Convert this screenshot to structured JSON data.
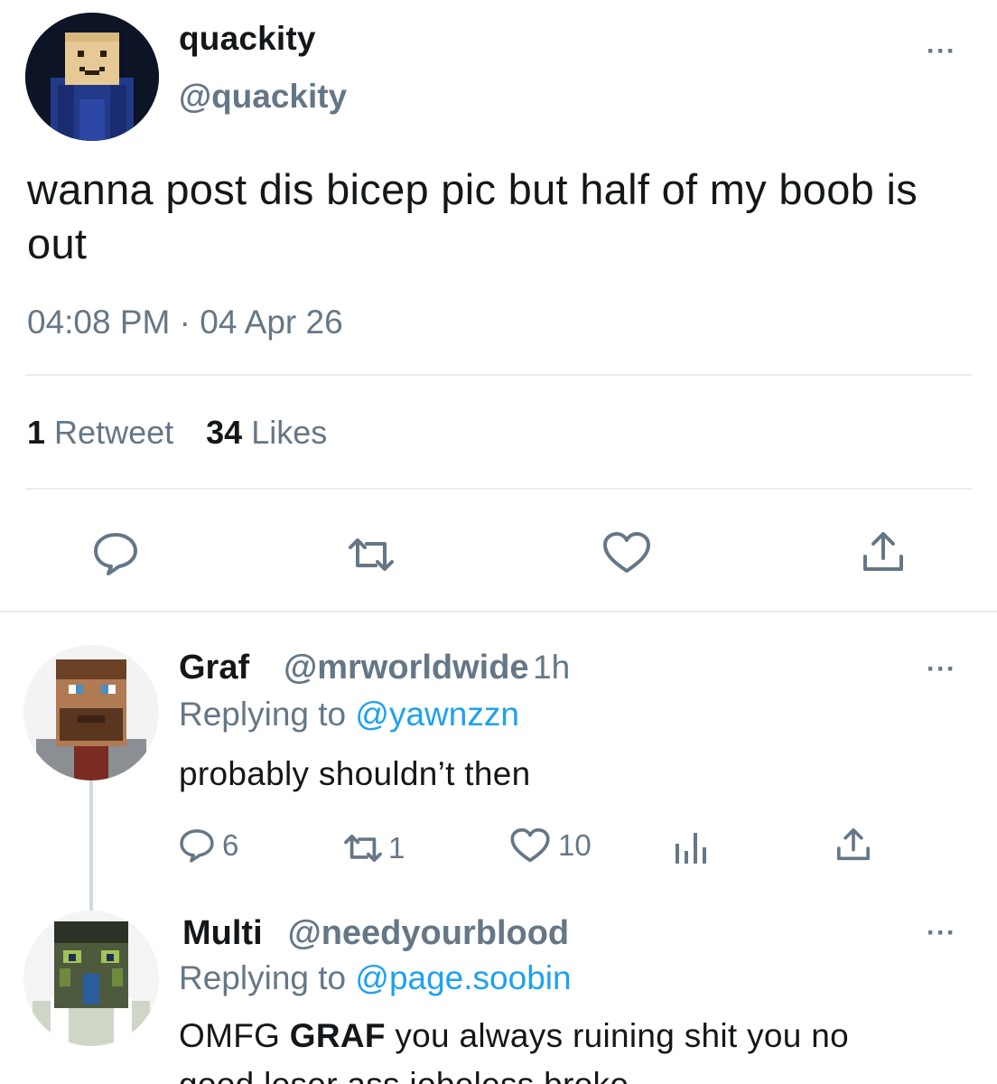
{
  "main_tweet": {
    "display_name": "quackity",
    "handle": "@quackity",
    "text": "wanna post dis bicep pic but half of my boob is out",
    "timestamp": "04:08 PM · 04 Apr 26",
    "retweets_count": "1",
    "retweets_label": "Retweet",
    "likes_count": "34",
    "likes_label": "Likes",
    "more": "···",
    "actions": [
      "reply-icon",
      "retweet-icon",
      "like-icon",
      "share-icon"
    ]
  },
  "replies": [
    {
      "display_name": "Graf",
      "handle": "@mrworldwide",
      "time": "1h",
      "replying_prefix": "Replying to",
      "replying_to": "@yawnzzn",
      "text": "probably shouldn’t then",
      "reply_count": "6",
      "retweet_count": "1",
      "like_count": "10",
      "more": "···"
    },
    {
      "display_name": "Multi",
      "handle": "@needyourblood",
      "replying_prefix": "Replying to",
      "replying_to": "@page.soobin",
      "text_part1": "OMFG ",
      "text_bold": "GRAF",
      "text_part2": " you always ruining shit you no",
      "text_line2": "good loser ass jobeless broke",
      "more": "···"
    }
  ],
  "colors": {
    "text": "#14171a",
    "secondary": "#657786",
    "link": "#1da1f2",
    "divider": "#e6ecf0"
  }
}
